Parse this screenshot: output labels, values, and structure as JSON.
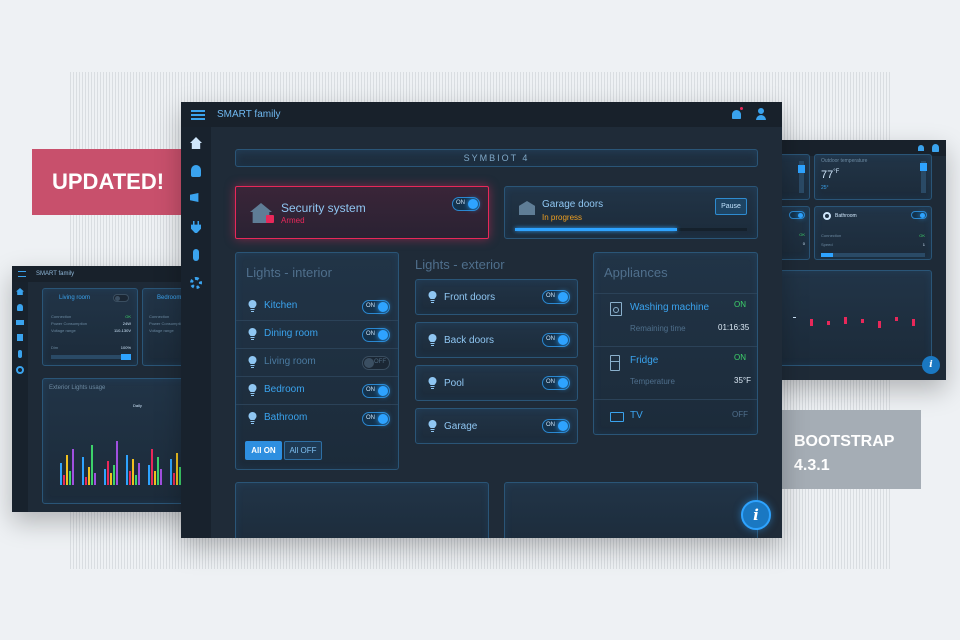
{
  "badges": {
    "updated": "UPDATED!",
    "bootstrap_line1": "BOOTSTRAP",
    "bootstrap_line2": "4.3.1"
  },
  "left_screen": {
    "title": "SMART family",
    "card1": {
      "title": "Living room",
      "rows": [
        [
          "Connection",
          "OK"
        ],
        [
          "Power Consumption",
          "24W"
        ],
        [
          "Voltage range",
          "110-130V"
        ]
      ],
      "dim_label": "Dim",
      "dim_value": "100%"
    },
    "card2": {
      "title": "Bedroom",
      "rows": [
        [
          "Connection",
          ""
        ],
        [
          "Power Consumption",
          ""
        ],
        [
          "Voltage range",
          ""
        ]
      ]
    },
    "chart_title": "Exterior Lights usage",
    "chart_subtitle": "Daily"
  },
  "right_screen": {
    "temp_label": "Outdoor temperature",
    "temp_value": "77",
    "temp_unit": "°F",
    "temp_sub": "25°",
    "bathroom": {
      "title": "Bathroom",
      "rows": [
        [
          "Connection",
          "OK"
        ],
        [
          "Speed",
          "1"
        ]
      ],
      "left_vals": [
        "OK",
        "0"
      ]
    }
  },
  "main": {
    "app_title": "SMART family",
    "banner": "SYMBIOT 4",
    "security": {
      "title": "Security system",
      "status": "Armed",
      "toggle": "ON"
    },
    "garage_doors": {
      "title": "Garage doors",
      "status": "In progress",
      "button": "Pause",
      "progress": 0.7
    },
    "lights_interior": {
      "title": "Lights - interior",
      "items": [
        {
          "label": "Kitchen",
          "state": "ON"
        },
        {
          "label": "Dining room",
          "state": "ON"
        },
        {
          "label": "Living room",
          "state": "OFF"
        },
        {
          "label": "Bedroom",
          "state": "ON"
        },
        {
          "label": "Bathroom",
          "state": "ON"
        }
      ],
      "all_on": "All ON",
      "all_off": "All OFF"
    },
    "lights_exterior": {
      "title": "Lights - exterior",
      "items": [
        {
          "label": "Front doors",
          "state": "ON"
        },
        {
          "label": "Back doors",
          "state": "ON"
        },
        {
          "label": "Pool",
          "state": "ON"
        },
        {
          "label": "Garage",
          "state": "ON"
        }
      ]
    },
    "appliances": {
      "title": "Appliances",
      "items": [
        {
          "label": "Washing machine",
          "state": "ON",
          "sub_label": "Remaining time",
          "sub_value": "01:16:35"
        },
        {
          "label": "Fridge",
          "state": "ON",
          "sub_label": "Temperature",
          "sub_value": "35°F"
        },
        {
          "label": "TV",
          "state": "OFF"
        }
      ]
    },
    "colors": {
      "accent": "#3aa3ee",
      "alert": "#e8285a",
      "on_green": "#3dd26a",
      "bg": "#1f2b38"
    }
  }
}
